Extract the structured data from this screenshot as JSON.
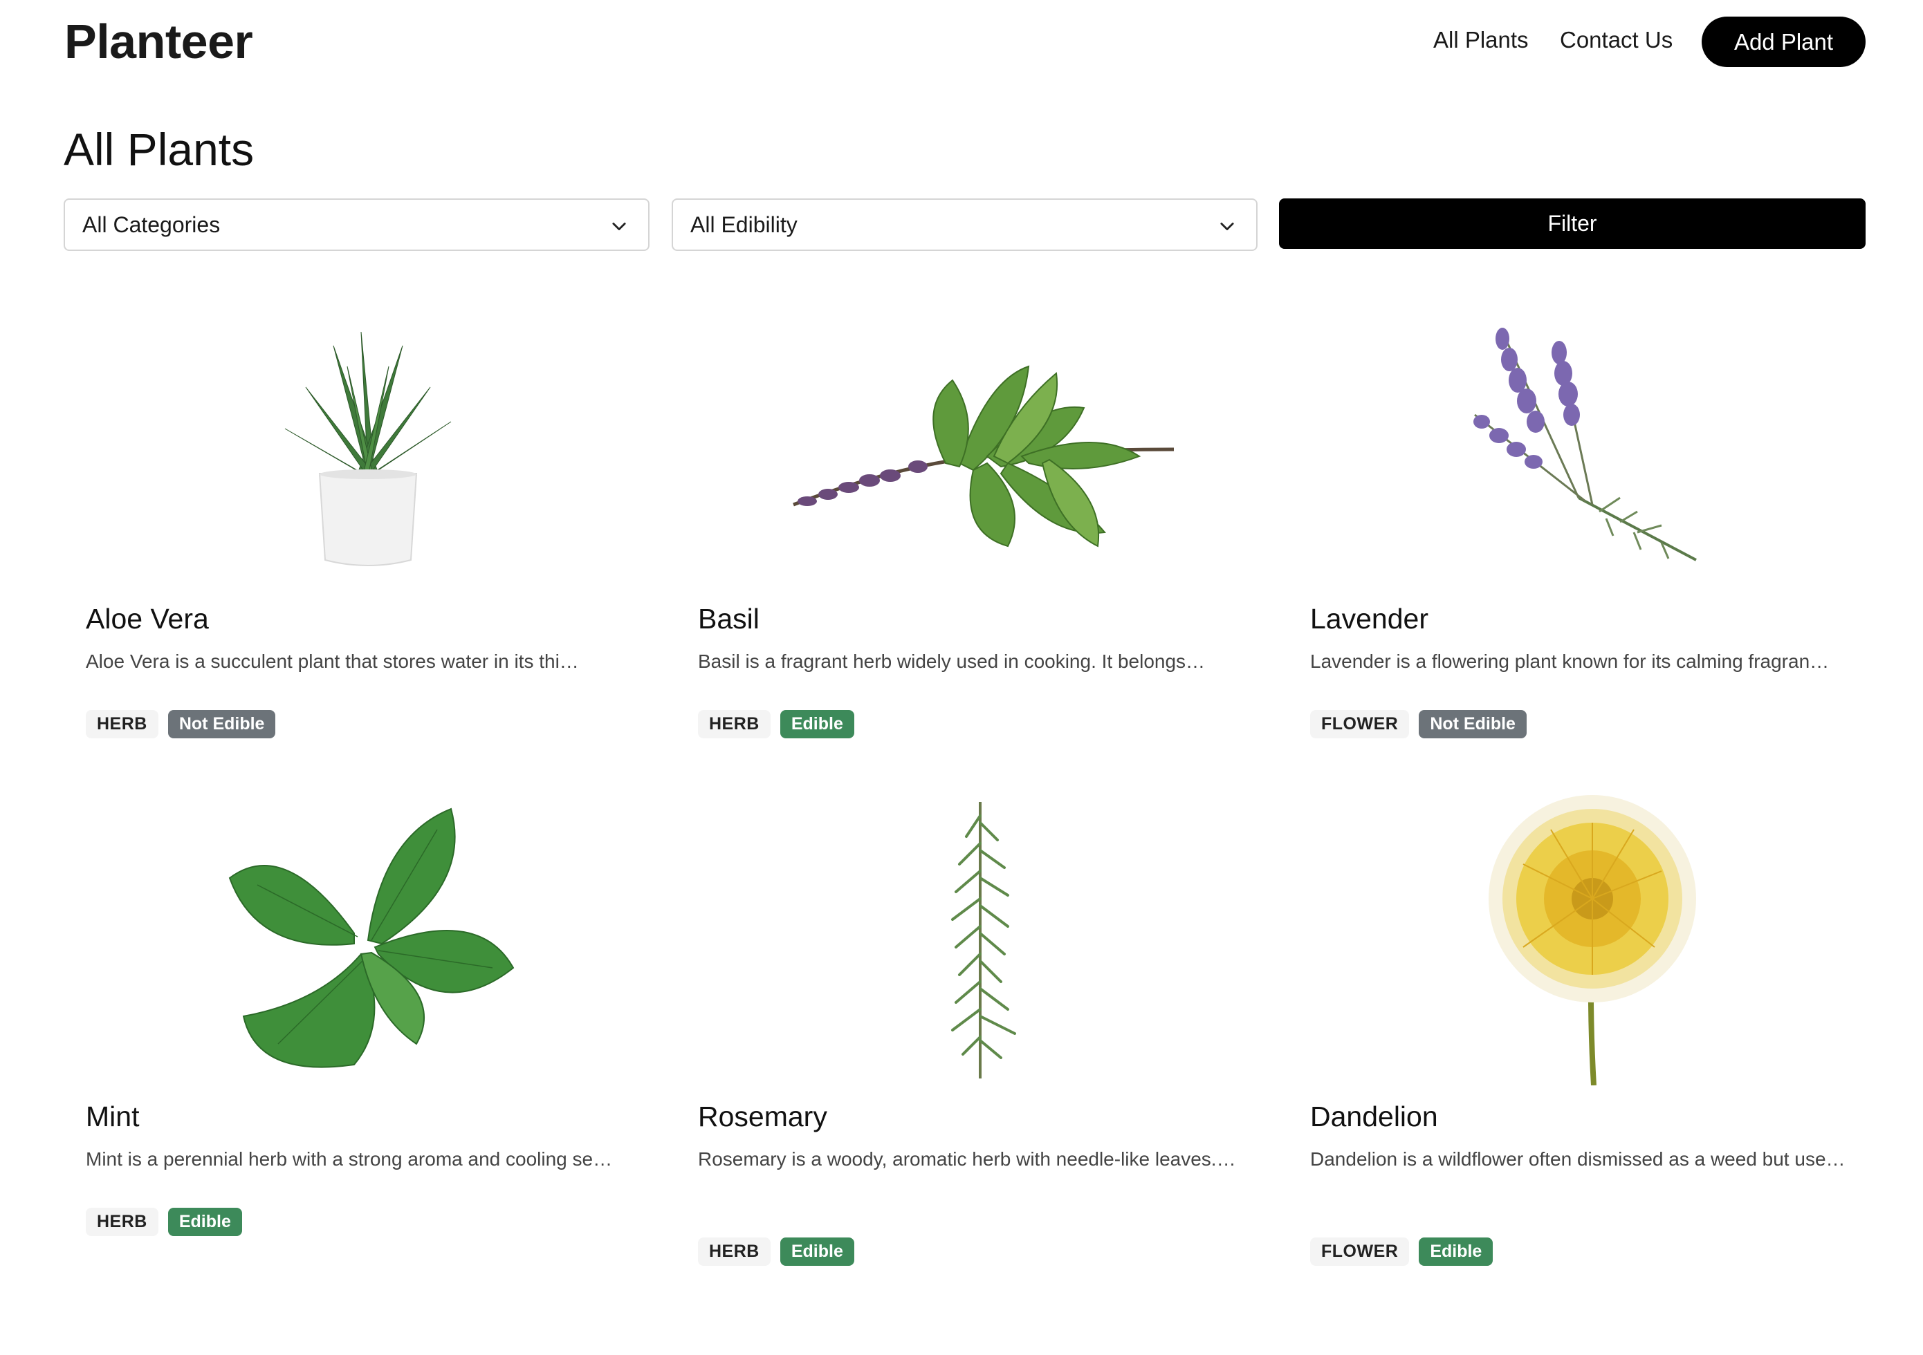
{
  "header": {
    "brand": "Planteer",
    "nav": {
      "all_plants": "All Plants",
      "contact_us": "Contact Us"
    },
    "add_plant": "Add Plant"
  },
  "page": {
    "title": "All Plants",
    "filters": {
      "category_selected": "All Categories",
      "edibility_selected": "All Edibility",
      "filter_button": "Filter"
    }
  },
  "plants": [
    {
      "name": "Aloe Vera",
      "description": "Aloe Vera is a succulent plant that stores water in its thi…",
      "category": "HERB",
      "edibility": "Not Edible",
      "image": "aloe-vera-icon"
    },
    {
      "name": "Basil",
      "description": "Basil is a fragrant herb widely used in cooking. It belongs…",
      "category": "HERB",
      "edibility": "Edible",
      "image": "basil-icon"
    },
    {
      "name": "Lavender",
      "description": "Lavender is a flowering plant known for its calming fragran…",
      "category": "FLOWER",
      "edibility": "Not Edible",
      "image": "lavender-icon"
    },
    {
      "name": "Mint",
      "description": "Mint is a perennial herb with a strong aroma and cooling se…",
      "category": "HERB",
      "edibility": "Edible",
      "image": "mint-icon"
    },
    {
      "name": "Rosemary",
      "description": "Rosemary is a woody, aromatic herb with needle-like leaves.…",
      "category": "HERB",
      "edibility": "Edible",
      "image": "rosemary-icon"
    },
    {
      "name": "Dandelion",
      "description": "Dandelion is a wildflower often dismissed as a weed but use…",
      "category": "FLOWER",
      "edibility": "Edible",
      "image": "dandelion-icon"
    }
  ],
  "colors": {
    "edible": "#3d8a5a",
    "not_edible": "#6c7379",
    "button": "#000000"
  }
}
